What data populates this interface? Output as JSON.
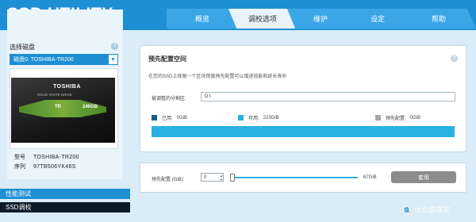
{
  "app": {
    "title": "SSD UTILITY"
  },
  "tabs": [
    {
      "label": "概览"
    },
    {
      "label": "调校选项"
    },
    {
      "label": "维护"
    },
    {
      "label": "设定"
    },
    {
      "label": "帮助"
    }
  ],
  "sidebar": {
    "select_disk_label": "选择磁盘",
    "help_glyph": "?",
    "disk_value": "磁盘0: TOSHIBA-TR200",
    "drive_image": {
      "brand": "TOSHIBA",
      "subtitle": "SOLID STATE DRIVE",
      "series": "TR",
      "capacity": "240GB"
    },
    "model_key": "型号",
    "model_value": "TOSHIBA-TR200",
    "serial_key": "序列",
    "serial_value": "97TB506YK46S",
    "nav": [
      {
        "label": "性能测试"
      },
      {
        "label": "SSD调校"
      }
    ]
  },
  "panel": {
    "title": "预先配置空间",
    "help_glyph": "?",
    "description": "在您的SSD上保留一个区块用做预先配置可以增进效能和延长寿命",
    "partition_label": "被调整的分割区:",
    "partition_value": "D:\\",
    "legend": [
      {
        "label": "已用:",
        "value": "0GiB",
        "color": "#1a5c8a"
      },
      {
        "label": "可用:",
        "value": "223GiB",
        "color": "#2ab1e4"
      },
      {
        "label": "预先配置:",
        "value": "0GiB",
        "color": "#a8a8a8"
      }
    ]
  },
  "overprovision": {
    "label": "预先配置 (GiB):",
    "value": "0",
    "max_label": "67GiB",
    "apply_label": "套用"
  },
  "watermark": {
    "logo": "值",
    "text": "什么值得买"
  },
  "colors": {
    "primary": "#1f8fd4",
    "bar": "#2ab1e4",
    "active_nav": "#0c1b28"
  }
}
